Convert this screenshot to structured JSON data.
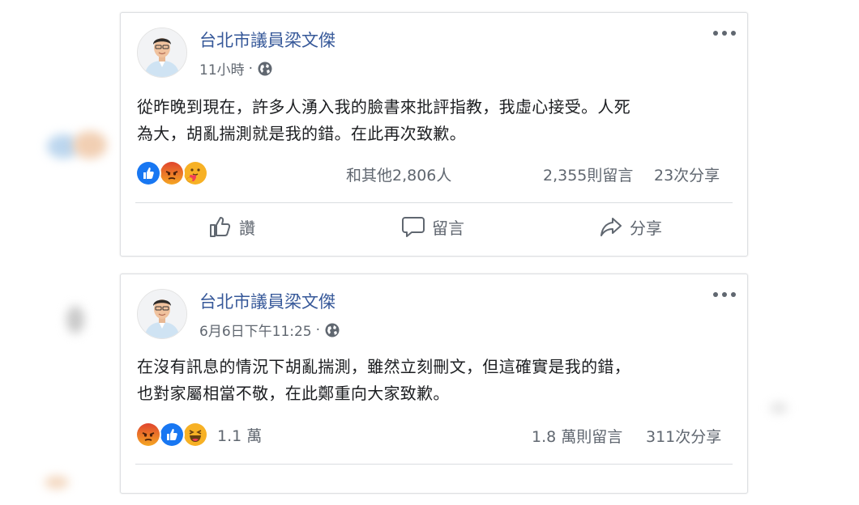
{
  "posts": [
    {
      "author": "台北市議員梁文傑",
      "time": "11小時",
      "text_lines": [
        "從昨晚到現在，許多人湧入我的臉書來批評指教，我虛心接受。人死",
        "為大，胡亂揣測就是我的錯。在此再次致歉。"
      ],
      "reaction_icons": [
        "like-icon",
        "angry-icon",
        "care-icon"
      ],
      "reaction_count": "和其他2,806人",
      "comments": "2,355則留言",
      "shares": "23次分享",
      "actions": {
        "like": "讚",
        "comment": "留言",
        "share": "分享"
      }
    },
    {
      "author": "台北市議員梁文傑",
      "time": "6月6日下午11:25",
      "text_lines": [
        "在沒有訊息的情況下胡亂揣測，雖然立刻刪文，但這確實是我的錯，",
        "也對家屬相當不敬，在此鄭重向大家致歉。"
      ],
      "reaction_icons": [
        "angry-icon",
        "like-icon",
        "haha-icon"
      ],
      "reaction_count": "1.1 萬",
      "comments": "1.8 萬則留言",
      "shares": "311次分享"
    }
  ],
  "colors": {
    "author": "#365899",
    "meta": "#606770",
    "like": "#1877f2",
    "angry": "#e9710f",
    "haha": "#f7b125"
  }
}
